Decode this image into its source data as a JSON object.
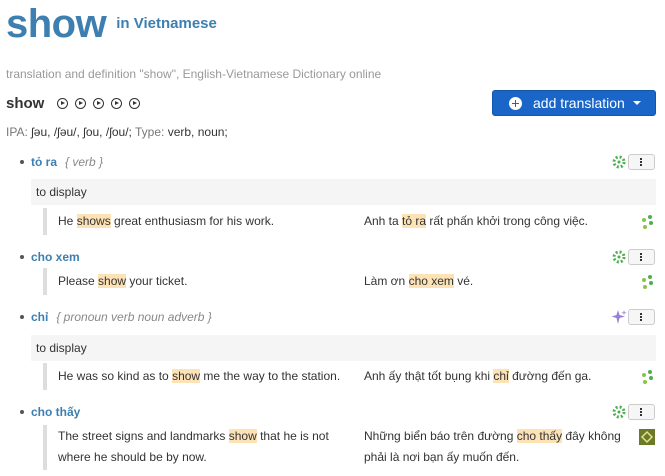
{
  "header": {
    "word": "show",
    "in_language": "in Vietnamese"
  },
  "subtitle": "translation and definition \"show\", English-Vietnamese Dictionary  online",
  "headword": "show",
  "audio_icons": [
    "play-icon",
    "play-icon",
    "play-icon",
    "play-icon",
    "play-icon"
  ],
  "add_button": {
    "label": "add translation"
  },
  "ipa": {
    "label": "IPA:",
    "value": "ʃəu, /ʃəu/, ʃou, /ʃou/;",
    "type_label": "Type:",
    "type_value": "verb, noun;"
  },
  "colors": {
    "accent": "#3c7fb0",
    "button": "#1a66c8",
    "highlight": "#fde2b6",
    "gloss_bg": "#f5f5f5"
  },
  "entries": [
    {
      "term": "tỏ ra",
      "pos": "{ verb }",
      "gloss": "to display",
      "example": {
        "src": [
          "He ",
          "shows",
          " great enthusiasm for his work."
        ],
        "tgt": [
          "Anh ta ",
          "tỏ ra",
          " rất phấn khởi trong công việc."
        ]
      }
    },
    {
      "term": "cho xem",
      "pos": "",
      "example": {
        "src": [
          "Please ",
          "show",
          " your ticket."
        ],
        "tgt": [
          "Làm ơn ",
          "cho xem",
          " vé."
        ]
      }
    },
    {
      "term": "chỉ",
      "pos": "{ pronoun verb noun adverb }",
      "gloss": "to display",
      "example": {
        "src": [
          "He was so kind as to ",
          "show",
          " me the way to the station."
        ],
        "tgt": [
          "Anh ấy thật tốt bụng khi ",
          "chỉ",
          " đường đến ga."
        ]
      }
    },
    {
      "term": "cho thấy",
      "pos": "",
      "example": {
        "src": [
          "The street signs and landmarks ",
          "show",
          " that he is not where he should be by now."
        ],
        "tgt": [
          "Những biển báo trên đường ",
          "cho thấy",
          " đây không phải là nơi bạn ấy muốn đến."
        ]
      }
    }
  ]
}
